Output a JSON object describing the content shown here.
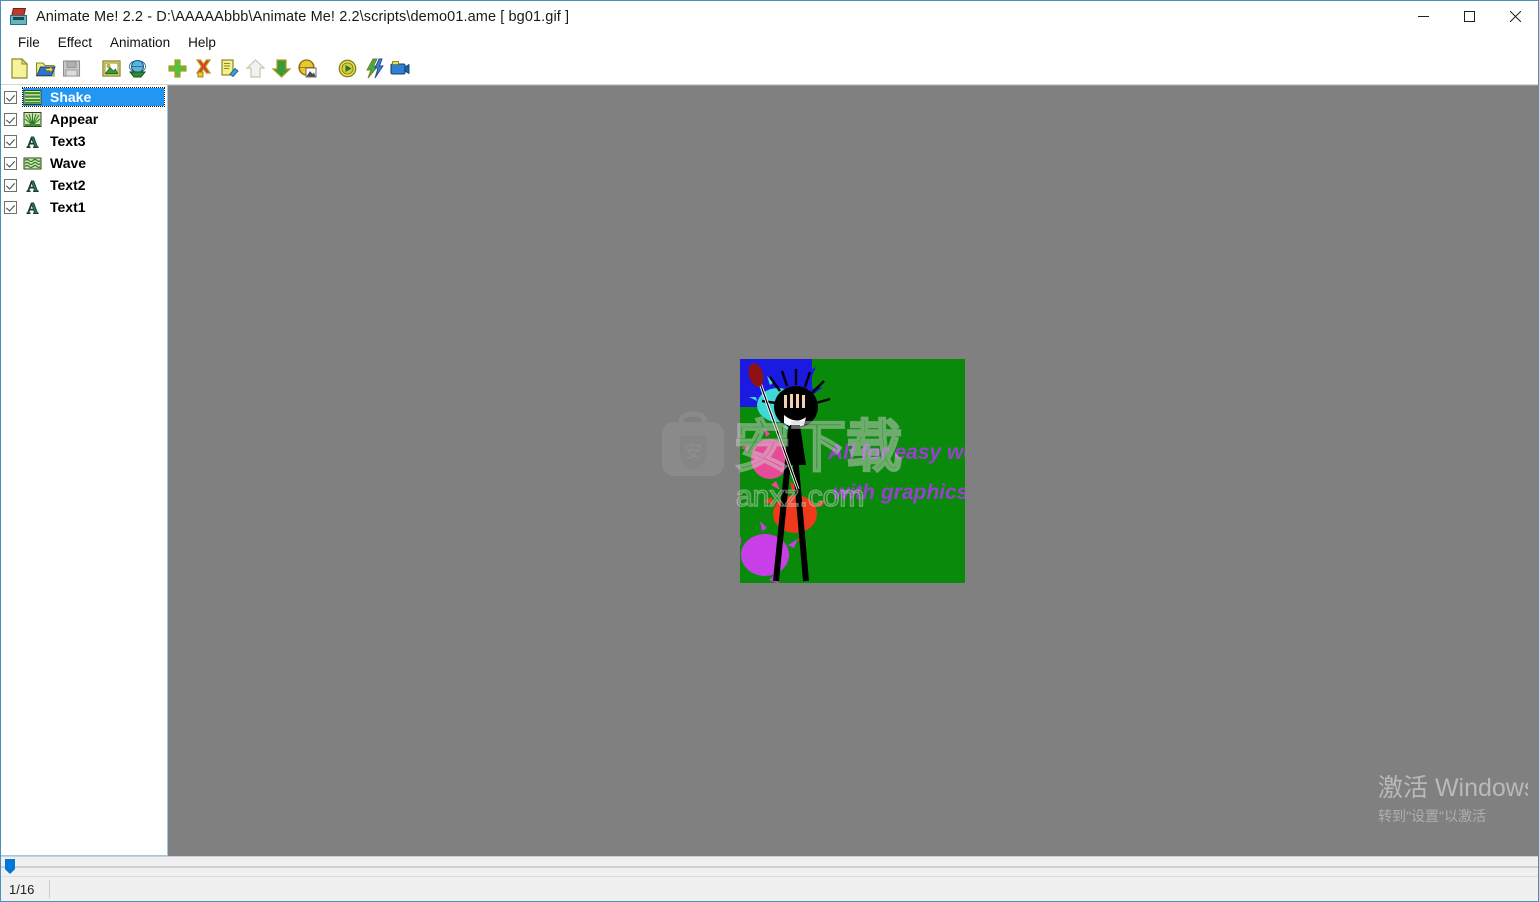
{
  "window": {
    "title": "Animate Me! 2.2 - D:\\AAAAAbbb\\Animate Me! 2.2\\scripts\\demo01.ame  [ bg01.gif ]",
    "icon": "animate-me-app-icon",
    "controls": {
      "minimize": "minimize-button",
      "maximize": "maximize-button",
      "close": "close-button"
    }
  },
  "menubar": {
    "items": [
      {
        "label": "File",
        "name": "menu-file"
      },
      {
        "label": "Effect",
        "name": "menu-effect"
      },
      {
        "label": "Animation",
        "name": "menu-animation"
      },
      {
        "label": "Help",
        "name": "menu-help"
      }
    ]
  },
  "toolbar": {
    "groups": [
      {
        "buttons": [
          {
            "name": "new-document-button",
            "icon": "new-page-icon",
            "enabled": true
          },
          {
            "name": "open-file-button",
            "icon": "open-folder-icon",
            "enabled": true
          },
          {
            "name": "save-file-button",
            "icon": "floppy-disk-icon",
            "enabled": false
          }
        ]
      },
      {
        "buttons": [
          {
            "name": "open-image-button",
            "icon": "picture-icon",
            "enabled": true
          },
          {
            "name": "export-image-button",
            "icon": "download-globe-icon",
            "enabled": true
          }
        ]
      },
      {
        "buttons": [
          {
            "name": "add-effect-button",
            "icon": "green-plus-icon",
            "enabled": true
          },
          {
            "name": "delete-effect-button",
            "icon": "red-cross-icon",
            "enabled": true
          },
          {
            "name": "edit-effect-button",
            "icon": "edit-pencil-icon",
            "enabled": true
          },
          {
            "name": "move-up-button",
            "icon": "arrow-up-icon",
            "enabled": false
          },
          {
            "name": "move-down-button",
            "icon": "arrow-down-icon",
            "enabled": true
          },
          {
            "name": "effect-properties-button",
            "icon": "globe-image-icon",
            "enabled": true
          }
        ]
      },
      {
        "buttons": [
          {
            "name": "preview-animation-button",
            "icon": "play-smiley-icon",
            "enabled": true
          },
          {
            "name": "fast-render-button",
            "icon": "lightning-icon",
            "enabled": true
          },
          {
            "name": "capture-video-button",
            "icon": "camera-icon",
            "enabled": true
          }
        ]
      }
    ]
  },
  "layer_panel": {
    "name": "effect-layer-list",
    "items": [
      {
        "label": "Shake",
        "icon": "stripes-icon",
        "checked": true,
        "selected": true
      },
      {
        "label": "Appear",
        "icon": "sunburst-icon",
        "checked": true,
        "selected": false
      },
      {
        "label": "Text3",
        "icon": "letter-a-icon",
        "checked": true,
        "selected": false
      },
      {
        "label": "Wave",
        "icon": "wave-icon",
        "checked": true,
        "selected": false
      },
      {
        "label": "Text2",
        "icon": "letter-a-icon",
        "checked": true,
        "selected": false
      },
      {
        "label": "Text1",
        "icon": "letter-a-icon",
        "checked": true,
        "selected": false
      }
    ]
  },
  "canvas": {
    "name": "animation-preview-canvas",
    "background_color": "#0a8a0a",
    "corner_color": "#1a1ae0",
    "text_lines": [
      "All for easy work",
      "with graphics!"
    ],
    "text_color": "#9b3fd1",
    "workspace_color": "#808080"
  },
  "watermark": {
    "logo_glyph": "安",
    "site_text": "anxz.com",
    "overlay_text": "安下载"
  },
  "bottom": {
    "slider_name": "frame-slider",
    "frame_counter": "1/16"
  },
  "activation": {
    "line1": "激活 Windows",
    "line2": "转到\"设置\"以激活"
  }
}
